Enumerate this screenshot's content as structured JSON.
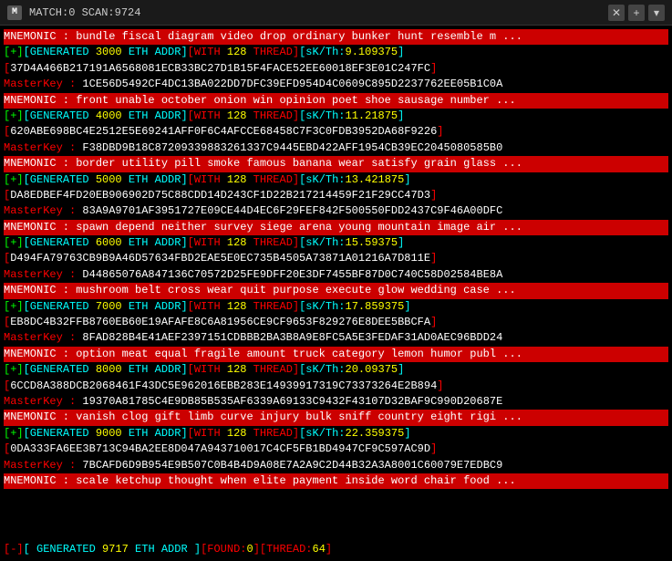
{
  "titlebar": {
    "icon": "M",
    "title": "MATCH:0 SCAN:9724",
    "close_label": "✕",
    "plus_label": "+",
    "chevron_label": "▾"
  },
  "entries": [
    {
      "mnemonic": "MNEMONIC : bundle fiscal diagram video drop ordinary bunker hunt resemble m ...",
      "generated": "[+][GENERATED 3000 ETH ADDR][WITH 128 THREAD][sK/Th:9.109375]",
      "hash1": "[37D4A466B217191A6568081ECB33BC27D1B15F4FACE52EE60018EF3E01C247FC]",
      "masterkey": "MasterKey :  1CE56D5492CF4DC13BA022DD7DFC39EFD954D4C0609C895D2237762EE05B1C0A"
    },
    {
      "mnemonic": "MNEMONIC : front unable october onion win opinion poet shoe sausage number ...",
      "generated": "[+][GENERATED 4000 ETH ADDR][WITH 128 THREAD][sK/Th:11.21875]",
      "hash1": "[620ABE698BC4E2512E5E69241AFF0F6C4AFCCE68458C7F3C0FDB3952DA68F9226]",
      "masterkey": "MasterKey :  F38DBD9B18C87209339883261337C9445EBD422AFF1954CB39EC2045080585B0"
    },
    {
      "mnemonic": "MNEMONIC : border utility pill smoke famous banana wear satisfy grain glass ...",
      "generated": "[+][GENERATED 5000 ETH ADDR][WITH 128 THREAD][sK/Th:13.421875]",
      "hash1": "[DA8EDBEF4FD20EB906902D75C88CDD14D243CF1D22B217214459F21F29CC47D3]",
      "masterkey": "MasterKey :  83A9A9701AF3951727E09CE44D4EC6F29FEF842F500550FDD2437C9F46A00DFC"
    },
    {
      "mnemonic": "MNEMONIC : spawn depend neither survey siege arena young mountain image air ...",
      "generated": "[+][GENERATED 6000 ETH ADDR][WITH 128 THREAD][sK/Th:15.59375]",
      "hash1": "[D494FA79763CB9B9A46D57634FBD2EAE5E0EC735B4505A73871A01216A7D811E]",
      "masterkey": "MasterKey :  D44865076A847136C70572D25FE9DFF20E3DF7455BF87D0C740C58D02584BE8A"
    },
    {
      "mnemonic": "MNEMONIC : mushroom belt cross wear quit purpose execute glow wedding case ...",
      "generated": "[+][GENERATED 7000 ETH ADDR][WITH 128 THREAD][sK/Th:17.859375]",
      "hash1": "[EB8DC4B32FFB8760EB60E19AFAFE8C6A81956CE9CF9653F829276E8DEE5BBCFA]",
      "masterkey": "MasterKey :  8FAD828B4E41AEF2397151CDBBB2BA3B8A9E8FC5A5E3FEDAF31AD0AEC96BDD24"
    },
    {
      "mnemonic": "MNEMONIC : option meat equal fragile amount truck category lemon humor publ ...",
      "generated": "[+][GENERATED 8000 ETH ADDR][WITH 128 THREAD][sK/Th:20.09375]",
      "hash1": "[6CCD8A388DCB2068461F43DC5E962016EBB283E14939917319C73373264E2B894]",
      "masterkey": "MasterKey :  19370A81785C4E9DB85B535AF6339A69133C9432F43107D32BAF9C990D20687E"
    },
    {
      "mnemonic": "MNEMONIC : vanish clog gift limb curve injury bulk sniff country eight rigi ...",
      "generated": "[+][GENERATED 9000 ETH ADDR][WITH 128 THREAD][sK/Th:22.359375]",
      "hash1": "[0DA333FA6EE3B713C94BA2EE8D047A943710017C4CF5FB1BD4947CF9C597AC9D]",
      "masterkey": "MasterKey :  7BCAFD6D9B954E9B507C0B4B4D9A08E7A2A9C2D44B32A3A8001C60079E7EDBC9"
    },
    {
      "mnemonic": "MNEMONIC : scale ketchup thought when elite payment inside word chair food ...",
      "generated": "",
      "hash1": "",
      "masterkey": ""
    }
  ],
  "status": {
    "label": "[-][ GENERATED 9717 ETH ADDR ][FOUND:0][THREAD:64]"
  }
}
